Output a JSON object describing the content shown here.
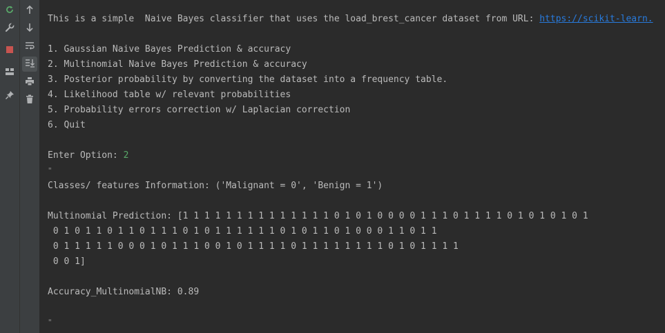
{
  "toolbar": {
    "left_icons": [
      {
        "name": "rerun-icon",
        "color": "#59a869"
      },
      {
        "name": "wrench-icon",
        "color": "#afb1b3"
      },
      {
        "name": "stop-icon",
        "color": "#c75450"
      },
      {
        "name": "layout-icon",
        "color": "#afb1b3"
      },
      {
        "name": "pin-icon",
        "color": "#afb1b3"
      }
    ],
    "right_icons": [
      {
        "name": "arrow-up-icon"
      },
      {
        "name": "arrow-down-icon"
      },
      {
        "name": "soft-wrap-icon"
      },
      {
        "name": "scroll-to-end-icon"
      },
      {
        "name": "print-icon"
      },
      {
        "name": "trash-icon"
      }
    ]
  },
  "console": {
    "intro_text": "This is a simple  Naive Bayes classifier that uses the load_brest_cancer dataset from URL: ",
    "intro_link": "https://scikit-learn.",
    "menu": [
      "1. Gaussian Naive Bayes Prediction & accuracy",
      "2. Multinomial Naive Bayes Prediction & accuracy",
      "3. Posterior probability by converting the dataset into a frequency table.",
      "4. Likelihood table w/ relevant probabilities",
      "5. Probability errors correction w/ Laplacian correction",
      "6. Quit"
    ],
    "prompt_label": "Enter Option: ",
    "prompt_value": "2",
    "quote_mark_1": "\"",
    "classes_info": "Classes/ features Information: ('Malignant = 0', 'Benign = 1')",
    "prediction_lines": [
      "Multinomial Prediction: [1 1 1 1 1 1 1 1 1 1 1 1 1 1 0 1 0 1 0 0 0 0 1 1 1 0 1 1 1 1 0 1 0 1 0 1 0 1",
      " 0 1 0 1 1 0 1 1 0 1 1 1 0 1 0 1 1 1 1 1 1 0 1 0 1 1 0 1 0 0 0 1 1 0 1 1",
      " 0 1 1 1 1 1 0 0 0 1 0 1 1 1 0 0 1 0 1 1 1 1 0 1 1 1 1 1 1 1 1 0 1 0 1 1 1 1",
      " 0 0 1]"
    ],
    "accuracy": "Accuracy_MultinomialNB: 0.89",
    "quote_mark_2": "\""
  }
}
